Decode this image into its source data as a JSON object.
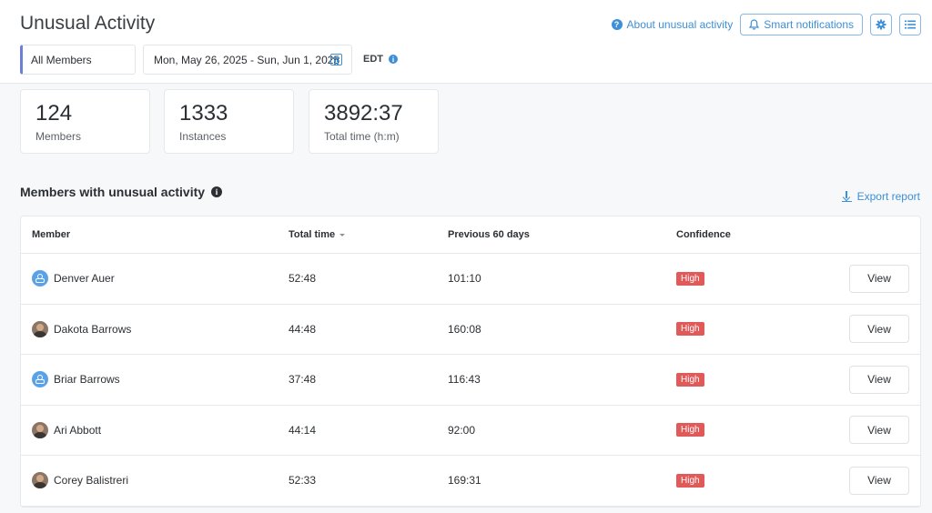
{
  "header": {
    "title": "Unusual Activity",
    "about_label": "About unusual activity",
    "smart_notifications_label": "Smart notifications"
  },
  "filters": {
    "members": "All Members",
    "date_range": "Mon, May 26, 2025 - Sun, Jun 1, 2025",
    "timezone": "EDT"
  },
  "stats": [
    {
      "value": "124",
      "label": "Members"
    },
    {
      "value": "1333",
      "label": "Instances"
    },
    {
      "value": "3892:37",
      "label": "Total time (h:m)"
    }
  ],
  "section": {
    "title": "Members with unusual activity",
    "export_label": "Export report"
  },
  "table": {
    "columns": [
      "Member",
      "Total time",
      "Previous 60 days",
      "Confidence"
    ],
    "view_label": "View",
    "rows": [
      {
        "name": "Denver Auer",
        "avatar": "default",
        "total_time": "52:48",
        "previous_60": "101:10",
        "confidence": "High"
      },
      {
        "name": "Dakota Barrows",
        "avatar": "photo",
        "total_time": "44:48",
        "previous_60": "160:08",
        "confidence": "High"
      },
      {
        "name": "Briar Barrows",
        "avatar": "default",
        "total_time": "37:48",
        "previous_60": "116:43",
        "confidence": "High"
      },
      {
        "name": "Ari Abbott",
        "avatar": "photo",
        "total_time": "44:14",
        "previous_60": "92:00",
        "confidence": "High"
      },
      {
        "name": "Corey Balistreri",
        "avatar": "photo",
        "total_time": "52:33",
        "previous_60": "169:31",
        "confidence": "High"
      }
    ]
  },
  "colors": {
    "accent": "#3d8fd8",
    "high_badge": "#e05a5a",
    "filter_accent": "#6b7fd8"
  }
}
